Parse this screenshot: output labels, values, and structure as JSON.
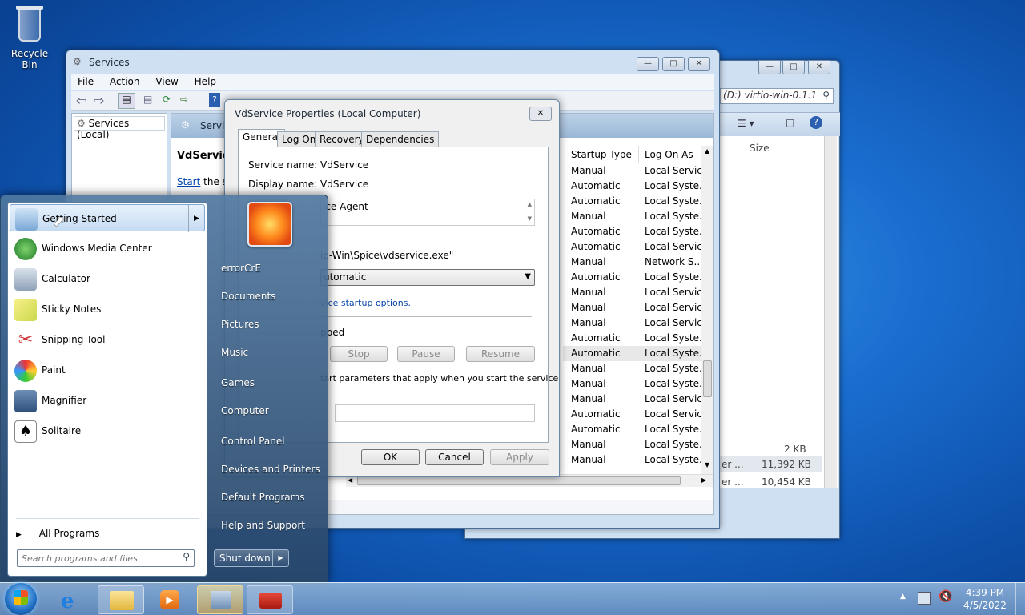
{
  "desktop": {
    "recycle_bin": "Recycle Bin"
  },
  "services_window": {
    "title": "Services",
    "menu": [
      "File",
      "Action",
      "View",
      "Help"
    ],
    "tree_item": "Services (Local)",
    "header_title": "Services",
    "service_name": "VdService",
    "start_link": "Start",
    "start_text": " the se"
  },
  "explorer_window": {
    "address": "(D:) virtio-win-0.1.1",
    "size_header": "Size",
    "sizes": [
      "2 KB",
      "11,392 KB",
      "10,454 KB"
    ],
    "row_prefix": [
      "er ...",
      "er ..."
    ]
  },
  "columns": {
    "startup": "Startup Type",
    "logon": "Log On As"
  },
  "service_rows": [
    {
      "startup": "Manual",
      "logon": "Local Service"
    },
    {
      "startup": "Automatic",
      "logon": "Local Syste..."
    },
    {
      "startup": "Automatic",
      "logon": "Local Syste..."
    },
    {
      "startup": "Manual",
      "logon": "Local Syste..."
    },
    {
      "startup": "Automatic",
      "logon": "Local Syste..."
    },
    {
      "startup": "Automatic",
      "logon": "Local Service"
    },
    {
      "startup": "Manual",
      "logon": "Network S..."
    },
    {
      "startup": "Automatic",
      "logon": "Local Syste..."
    },
    {
      "startup": "Manual",
      "logon": "Local Service"
    },
    {
      "startup": "Manual",
      "logon": "Local Service"
    },
    {
      "startup": "Manual",
      "logon": "Local Service"
    },
    {
      "startup": "Automatic",
      "logon": "Local Syste..."
    },
    {
      "startup": "Automatic",
      "logon": "Local Syste..."
    },
    {
      "startup": "Manual",
      "logon": "Local Syste..."
    },
    {
      "startup": "Manual",
      "logon": "Local Syste..."
    },
    {
      "startup": "Manual",
      "logon": "Local Service"
    },
    {
      "startup": "Automatic",
      "logon": "Local Service"
    },
    {
      "startup": "Automatic",
      "logon": "Local Syste..."
    },
    {
      "startup": "Manual",
      "logon": "Local Syste..."
    },
    {
      "startup": "Manual",
      "logon": "Local Syste..."
    }
  ],
  "dialog": {
    "title": "VdService Properties (Local Computer)",
    "tabs": [
      "General",
      "Log On",
      "Recovery",
      "Dependencies"
    ],
    "service_name_label": "Service name:",
    "service_name_value": "VdService",
    "display_name_label": "Display name:",
    "display_name_value": "VdService",
    "description": "ice Agent",
    "path": "io-Win\\Spice\\vdservice.exe\"",
    "startup_value": "utomatic",
    "startup_link": "vice startup options.",
    "status": "pped",
    "stop": "Stop",
    "pause": "Pause",
    "resume": "Resume",
    "params_text": "tart parameters that apply when you start the service",
    "ok": "OK",
    "cancel": "Cancel",
    "apply": "Apply"
  },
  "start_menu": {
    "programs": [
      "Getting Started",
      "Windows Media Center",
      "Calculator",
      "Sticky Notes",
      "Snipping Tool",
      "Paint",
      "Magnifier",
      "Solitaire"
    ],
    "all_programs": "All Programs",
    "search_placeholder": "Search programs and files",
    "right": [
      "errorCrE",
      "Documents",
      "Pictures",
      "Music",
      "Games",
      "Computer",
      "Control Panel",
      "Devices and Printers",
      "Default Programs",
      "Help and Support"
    ],
    "shutdown": "Shut down"
  },
  "taskbar": {
    "time": "4:39 PM",
    "date": "4/5/2022"
  }
}
